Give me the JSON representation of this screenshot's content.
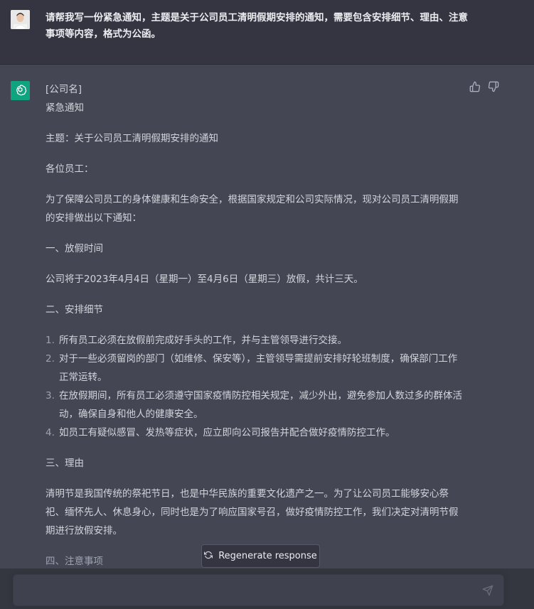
{
  "user_message": "请帮我写一份紧急通知，主题是关于公司员工清明假期安排的通知，需要包含安排细节、理由、注意事项等内容，格式为公函。",
  "response": {
    "company": "[公司名]",
    "notice_type": "紧急通知",
    "subject": "主题：关于公司员工清明假期安排的通知",
    "greeting": "各位员工：",
    "intro": "为了保障公司员工的身体健康和生命安全，根据国家规定和公司实际情况，现对公司员工清明假期的安排做出以下通知：",
    "section1_title": "一、放假时间",
    "section1_body": "公司将于2023年4月4日（星期一）至4月6日（星期三）放假，共计三天。",
    "section2_title": "二、安排细节",
    "section2_items": [
      "所有员工必须在放假前完成好手头的工作，并与主管领导进行交接。",
      "对于一些必须留岗的部门（如维修、保安等），主管领导需提前安排好轮班制度，确保部门工作正常运转。",
      "在放假期间，所有员工必须遵守国家疫情防控相关规定，减少外出，避免参加人数过多的群体活动，确保自身和他人的健康安全。",
      "如员工有疑似感冒、发热等症状，应立即向公司报告并配合做好疫情防控工作。"
    ],
    "section3_title": "三、理由",
    "section3_body": "清明节是我国传统的祭祀节日，也是中华民族的重要文化遗产之一。为了让公司员工能够安心祭祀、缅怀先人、休息身心，同时也是为了响应国家号召，做好疫情防控工作，我们决定对清明节假期进行放假安排。",
    "section4_title": "四、注意事项"
  },
  "regenerate_label": "Regenerate response",
  "input": {
    "placeholder": "",
    "value": ""
  },
  "colors": {
    "gpt_green": "#10a37f",
    "bot_bg": "#444654",
    "user_bg": "#343541"
  }
}
